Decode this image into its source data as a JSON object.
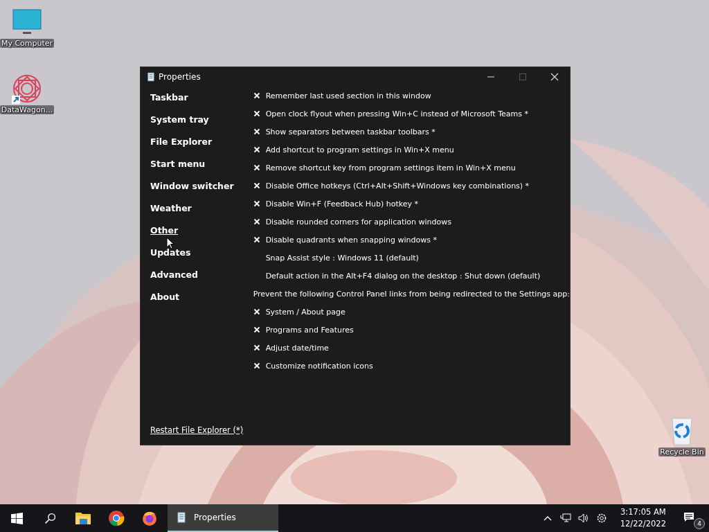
{
  "desktop": {
    "icons": [
      {
        "label": "My Computer",
        "kind": "monitor"
      },
      {
        "label": "DataWagon...",
        "kind": "star"
      },
      {
        "label": "Recycle Bin",
        "kind": "bin"
      }
    ]
  },
  "window": {
    "title": "Properties",
    "sidebar": {
      "items": [
        {
          "label": "Taskbar",
          "selected": false
        },
        {
          "label": "System tray",
          "selected": false
        },
        {
          "label": "File Explorer",
          "selected": false
        },
        {
          "label": "Start menu",
          "selected": false
        },
        {
          "label": "Window switcher",
          "selected": false
        },
        {
          "label": "Weather",
          "selected": false
        },
        {
          "label": "Other",
          "selected": true
        },
        {
          "label": "Updates",
          "selected": false
        },
        {
          "label": "Advanced",
          "selected": false
        },
        {
          "label": "About",
          "selected": false
        }
      ],
      "footer_link": "Restart File Explorer (*)"
    },
    "options": [
      {
        "kind": "checkbox",
        "label": "Remember last used section in this window",
        "checked": false
      },
      {
        "kind": "checkbox",
        "label": "Open clock flyout when pressing Win+C instead of Microsoft Teams *",
        "checked": false
      },
      {
        "kind": "checkbox",
        "label": "Show separators between taskbar toolbars *",
        "checked": false
      },
      {
        "kind": "checkbox",
        "label": "Add shortcut to program settings in Win+X menu",
        "checked": false
      },
      {
        "kind": "checkbox",
        "label": "Remove shortcut key from program settings item in Win+X menu",
        "checked": false
      },
      {
        "kind": "checkbox",
        "label": "Disable Office hotkeys (Ctrl+Alt+Shift+Windows key combinations) *",
        "checked": false
      },
      {
        "kind": "checkbox",
        "label": "Disable Win+F (Feedback Hub) hotkey *",
        "checked": false
      },
      {
        "kind": "checkbox",
        "label": "Disable rounded corners for application windows",
        "checked": false
      },
      {
        "kind": "checkbox",
        "label": "Disable quadrants when snapping windows *",
        "checked": false
      },
      {
        "kind": "choice",
        "label": "Snap Assist style : Windows 11 (default)"
      },
      {
        "kind": "choice",
        "label": "Default action in the Alt+F4 dialog on the desktop : Shut down (default)"
      },
      {
        "kind": "heading",
        "label": "Prevent the following Control Panel links from being redirected to the Settings app:"
      },
      {
        "kind": "checkbox",
        "label": "System / About page",
        "checked": false
      },
      {
        "kind": "checkbox",
        "label": "Programs and Features",
        "checked": false
      },
      {
        "kind": "checkbox",
        "label": "Adjust date/time",
        "checked": false
      },
      {
        "kind": "checkbox",
        "label": "Customize notification icons",
        "checked": false
      }
    ]
  },
  "taskbar": {
    "apps": [
      {
        "kind": "folder"
      },
      {
        "kind": "chrome"
      },
      {
        "kind": "firefox"
      }
    ],
    "task_button": {
      "label": "Properties",
      "selected": true
    },
    "clock": {
      "time": "3:17:05 AM",
      "date": "12/22/2022"
    },
    "notifications": {
      "count": "4"
    }
  }
}
